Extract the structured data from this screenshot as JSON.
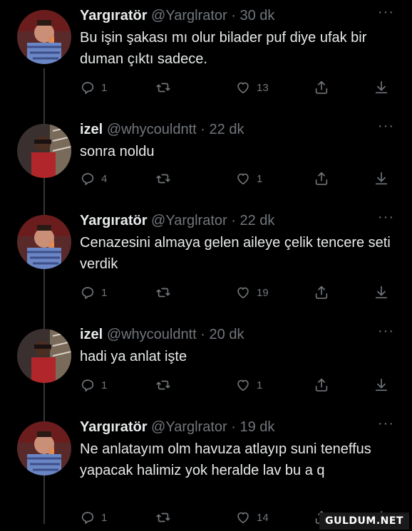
{
  "tweets": [
    {
      "name": "Yargıratör",
      "handle": "@Yarglrator",
      "dot": "·",
      "time": "30 dk",
      "text": "Bu işin şakası mı olur bilader puf diye ufak bir duman çıktı sadece.",
      "replies": "1",
      "retweets": "",
      "likes": "13",
      "avatar": "yargi"
    },
    {
      "name": "izel",
      "handle": "@whycouldntt",
      "dot": "·",
      "time": "22 dk",
      "text": "sonra noldu",
      "replies": "4",
      "retweets": "",
      "likes": "1",
      "avatar": "izel"
    },
    {
      "name": "Yargıratör",
      "handle": "@Yarglrator",
      "dot": "·",
      "time": "22 dk",
      "text": "Cenazesini almaya gelen aileye çelik tencere seti verdik",
      "replies": "1",
      "retweets": "",
      "likes": "19",
      "avatar": "yargi"
    },
    {
      "name": "izel",
      "handle": "@whycouldntt",
      "dot": "·",
      "time": "20 dk",
      "text": "hadi ya anlat işte",
      "replies": "1",
      "retweets": "",
      "likes": "1",
      "avatar": "izel"
    },
    {
      "name": "Yargıratör",
      "handle": "@Yarglrator",
      "dot": "·",
      "time": "19 dk",
      "text": "Ne anlatayım olm havuza atlayıp suni teneffus yapacak halimiz yok heralde lav bu a q",
      "replies": "1",
      "retweets": "",
      "likes": "14",
      "avatar": "yargi"
    }
  ],
  "more_label": "···",
  "watermark": "GULDUM.NET",
  "icons": {
    "reply": "reply-icon",
    "retweet": "retweet-icon",
    "like": "heart-icon",
    "share": "share-icon",
    "download": "download-icon"
  },
  "colors": {
    "background": "#000000",
    "text": "#e7e9ea",
    "muted": "#71767b",
    "thread_line": "#333639"
  }
}
